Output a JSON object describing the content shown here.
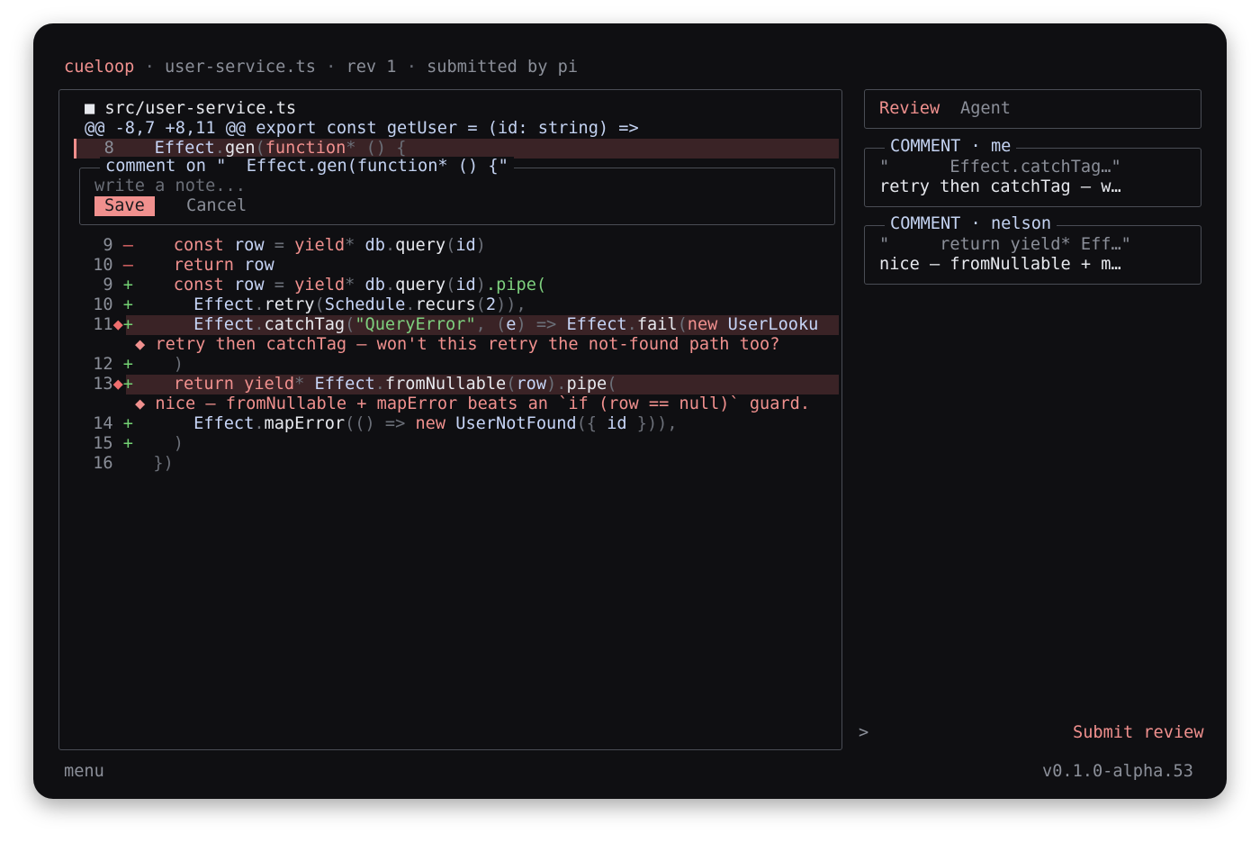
{
  "header": {
    "app": "cueloop",
    "file": "user-service.ts",
    "rev": "rev 1",
    "submitted": "submitted by pi",
    "separator": "·"
  },
  "diff": {
    "file_title": "■ src/user-service.ts",
    "hunk": "@@ -8,7 +8,11 @@ export const getUser = (id: string) =>",
    "selected_line": {
      "num": "8",
      "code": "Effect.gen(function* () {"
    },
    "comment_editor": {
      "legend": "comment on \"  Effect.gen(function* () {\"",
      "placeholder": "write a note...",
      "save_label": "Save",
      "cancel_label": "Cancel"
    },
    "notes": {
      "n1": "◆ retry then catchTag – won't this retry the not-found path too?",
      "n2": "◆ nice – fromNullable + mapError beats an `if (row == null)` guard."
    }
  },
  "sidebar": {
    "tabs": {
      "review": "Review",
      "agent": "Agent"
    },
    "comments": [
      {
        "legend": "COMMENT · me",
        "quote": "\"      Effect.catchTag…\"",
        "text": "retry then catchTag – w…"
      },
      {
        "legend": "COMMENT · nelson",
        "quote": "\"     return yield* Eff…\"",
        "text": "nice – fromNullable + m…"
      }
    ]
  },
  "prompt": ">",
  "submit_label": "Submit review",
  "footer": {
    "menu": "menu",
    "version": "v0.1.0-alpha.53"
  },
  "colors": {
    "accent": "#f0908e",
    "added": "#74d274",
    "removed": "#ef6e6e",
    "selected_bg": "#3a2326",
    "background": "#0f0f12"
  }
}
